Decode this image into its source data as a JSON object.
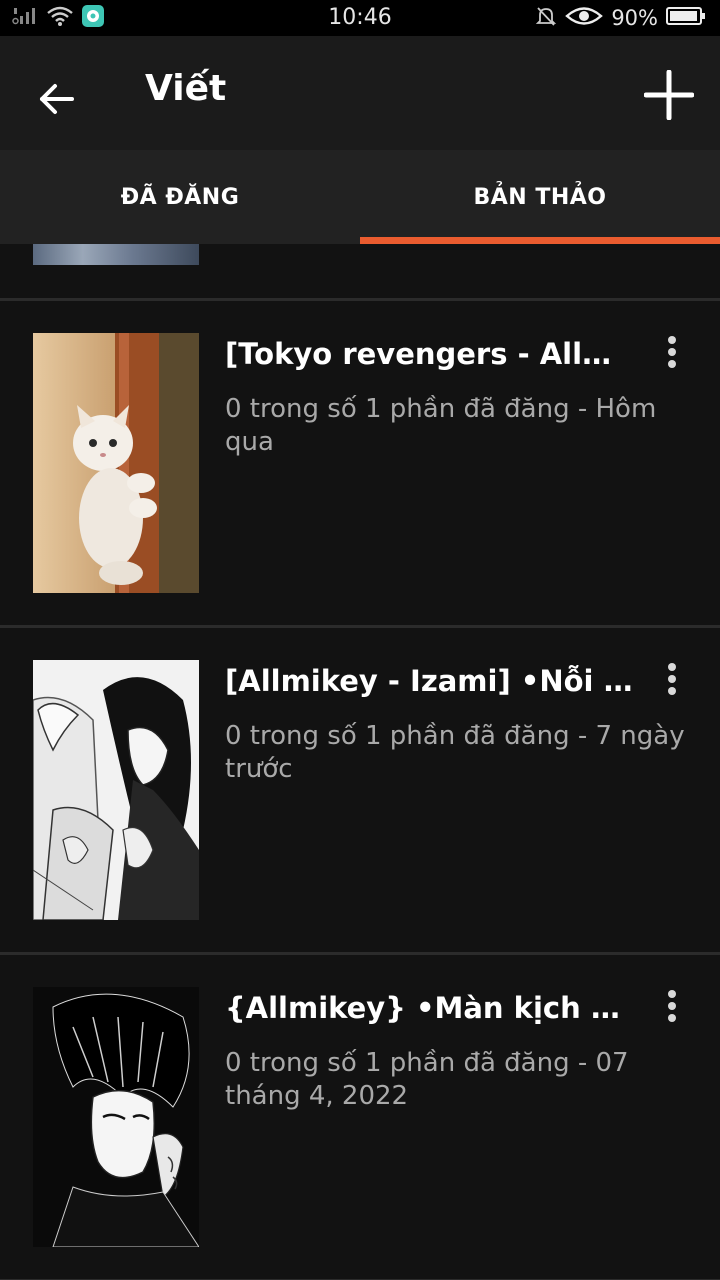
{
  "status_bar": {
    "time": "10:46",
    "battery": "90%",
    "icons": [
      "signal-icon",
      "wifi-icon",
      "app-notification-icon",
      "mute-bell-icon",
      "eye-icon",
      "battery-icon"
    ]
  },
  "app_bar": {
    "title": "Viết",
    "back_icon": "back-arrow-icon",
    "add_icon": "plus-icon"
  },
  "tabs": [
    {
      "label": "ĐÃ ĐĂNG",
      "active": false
    },
    {
      "label": "BẢN THẢO",
      "active": true
    }
  ],
  "accent_color": "#ea5c2f",
  "stories": [
    {
      "title": "[Tokyo revengers - Allmikey] ...",
      "meta": "0 trong số 1 phần đã đăng - Hôm qua",
      "cover": "kitten-cover"
    },
    {
      "title": "[Allmikey - Izami] •Nỗi ...",
      "meta": "0 trong số 1 phần đã đăng - 7 ngày trước",
      "cover": "manga-couple-cover"
    },
    {
      "title": "{Allmikey} •Màn kịch hoàn hảo...",
      "meta": "0 trong số 1 phần đã đăng - 07 tháng 4, 2022",
      "cover": "manga-boy-cover"
    }
  ]
}
